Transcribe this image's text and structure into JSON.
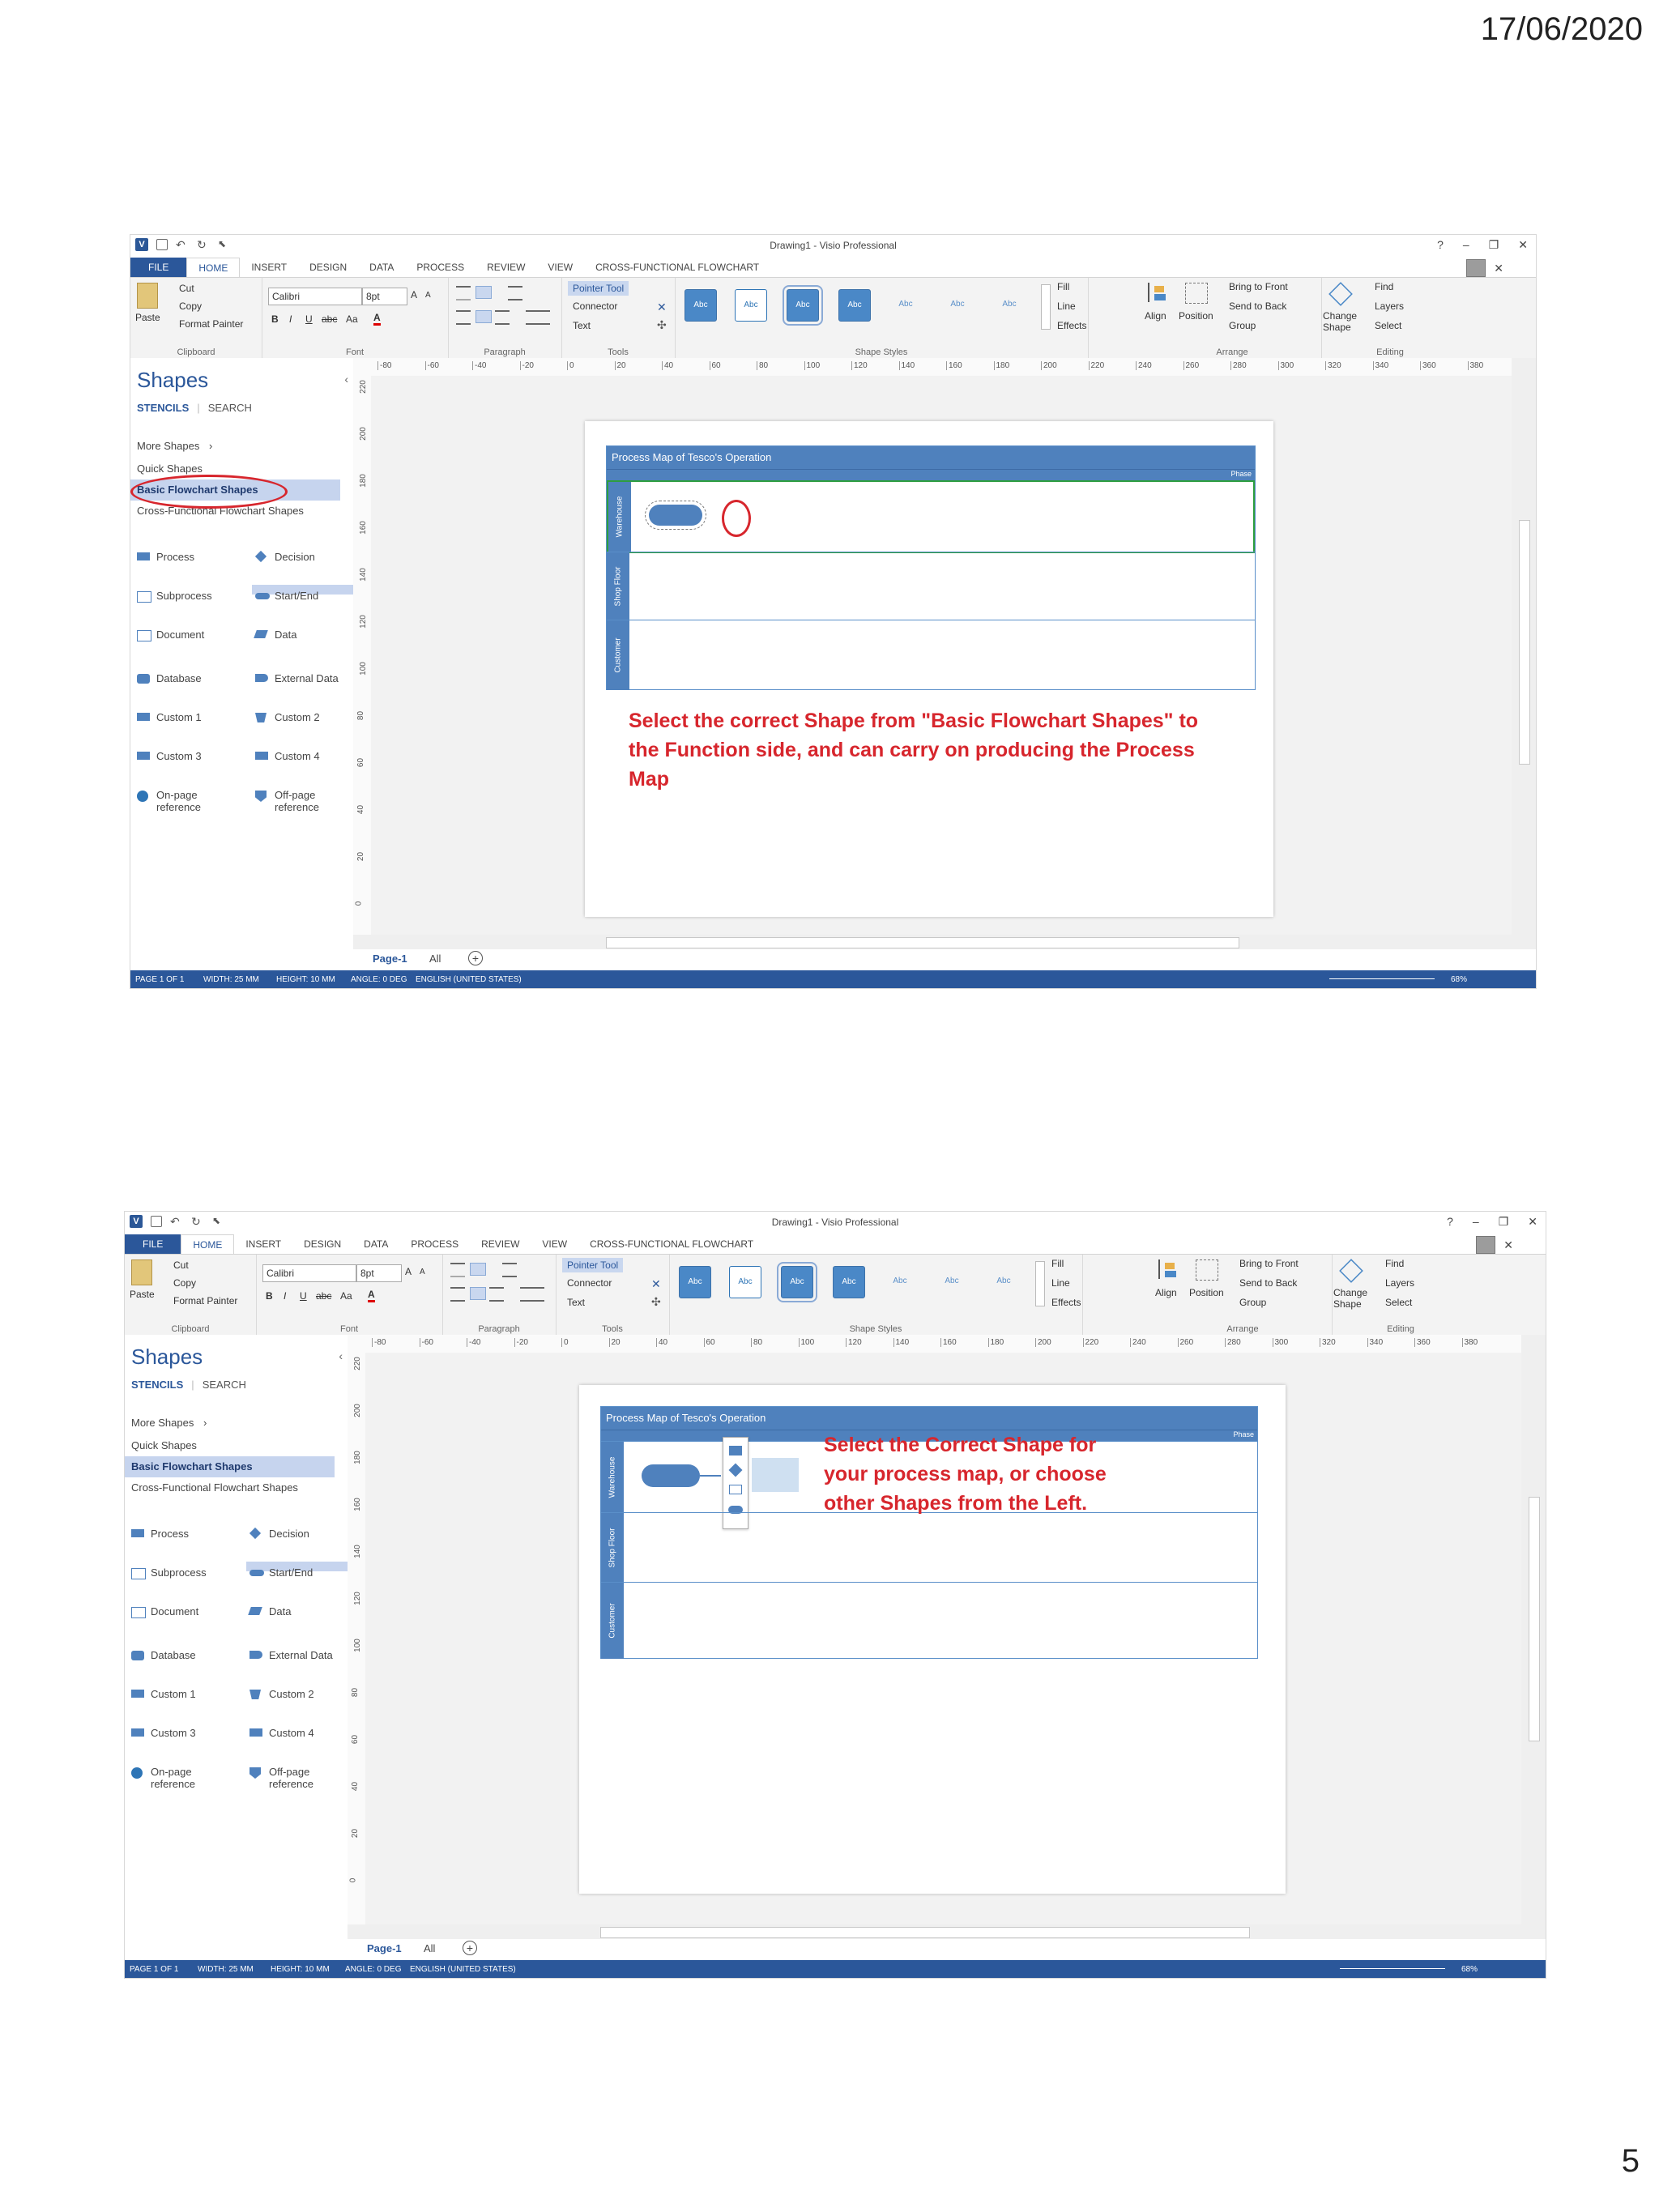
{
  "slide": {
    "date": "17/06/2020",
    "page_number": "5"
  },
  "app": {
    "window_title": "Drawing1 - Visio Professional",
    "help": "?",
    "tabs": [
      "FILE",
      "HOME",
      "INSERT",
      "DESIGN",
      "DATA",
      "PROCESS",
      "REVIEW",
      "VIEW",
      "CROSS-FUNCTIONAL FLOWCHART"
    ],
    "ribbon": {
      "clipboard": {
        "label": "Clipboard",
        "paste": "Paste",
        "cut": "Cut",
        "copy": "Copy",
        "format_painter": "Format Painter"
      },
      "font": {
        "label": "Font",
        "family": "Calibri",
        "size": "8pt",
        "grow": "A",
        "shrink": "A",
        "bold": "B",
        "italic": "I",
        "underline": "U",
        "strike": "abc",
        "case": "Aa",
        "color": "A"
      },
      "paragraph": {
        "label": "Paragraph"
      },
      "tools": {
        "label": "Tools",
        "pointer": "Pointer Tool",
        "connector": "Connector",
        "text": "Text"
      },
      "shape_styles": {
        "label": "Shape Styles",
        "swatch": "Abc"
      },
      "shape_format": {
        "fill": "Fill",
        "line": "Line",
        "effects": "Effects"
      },
      "arrange": {
        "label": "Arrange",
        "align": "Align",
        "position": "Position",
        "bring_front": "Bring to Front",
        "send_back": "Send to Back",
        "group": "Group"
      },
      "editing": {
        "label": "Editing",
        "change_shape": "Change Shape",
        "find": "Find",
        "layers": "Layers",
        "select": "Select"
      }
    },
    "shapes_pane": {
      "title": "Shapes",
      "tab_stencils": "STENCILS",
      "tab_search": "SEARCH",
      "more_shapes": "More Shapes",
      "stencils": [
        "Quick Shapes",
        "Basic Flowchart Shapes",
        "Cross-Functional Flowchart Shapes"
      ],
      "shapes": [
        [
          "Process",
          "Decision"
        ],
        [
          "Subprocess",
          "Start/End"
        ],
        [
          "Document",
          "Data"
        ],
        [
          "Database",
          "External Data"
        ],
        [
          "Custom 1",
          "Custom 2"
        ],
        [
          "Custom 3",
          "Custom 4"
        ],
        [
          "On-page reference",
          "Off-page reference"
        ]
      ]
    },
    "ruler_h": [
      "-80",
      "-60",
      "-40",
      "-20",
      "0",
      "20",
      "40",
      "60",
      "80",
      "100",
      "120",
      "140",
      "160",
      "180",
      "200",
      "220",
      "240",
      "260",
      "280",
      "300",
      "320",
      "340",
      "360",
      "380"
    ],
    "ruler_v": [
      "220",
      "200",
      "180",
      "160",
      "140",
      "120",
      "100",
      "80",
      "60",
      "40",
      "20",
      "0"
    ],
    "page_tab": "Page-1",
    "all_tab": "All",
    "status": {
      "page": "PAGE 1 OF 1",
      "width": "WIDTH: 25 MM",
      "height": "HEIGHT: 10 MM",
      "angle": "ANGLE: 0 DEG",
      "language": "ENGLISH (UNITED STATES)",
      "zoom": "68%"
    },
    "diagram": {
      "title": "Process Map of Tesco's Operation",
      "phase": "Phase",
      "lanes": [
        "Warehouse",
        "Shop Floor",
        "Customer"
      ]
    }
  },
  "annotations": {
    "first": "Select the correct Shape from \"Basic Flowchart Shapes\" to the Function side, and can carry on producing the Process Map",
    "second": "Select the Correct Shape for your process map, or choose other Shapes from the Left."
  },
  "colors": {
    "accent": "#2b579a",
    "lane": "#4f81bd",
    "note": "#d7262d",
    "highlight_ring": "#d7262d",
    "selection": "#2e9e3f"
  }
}
